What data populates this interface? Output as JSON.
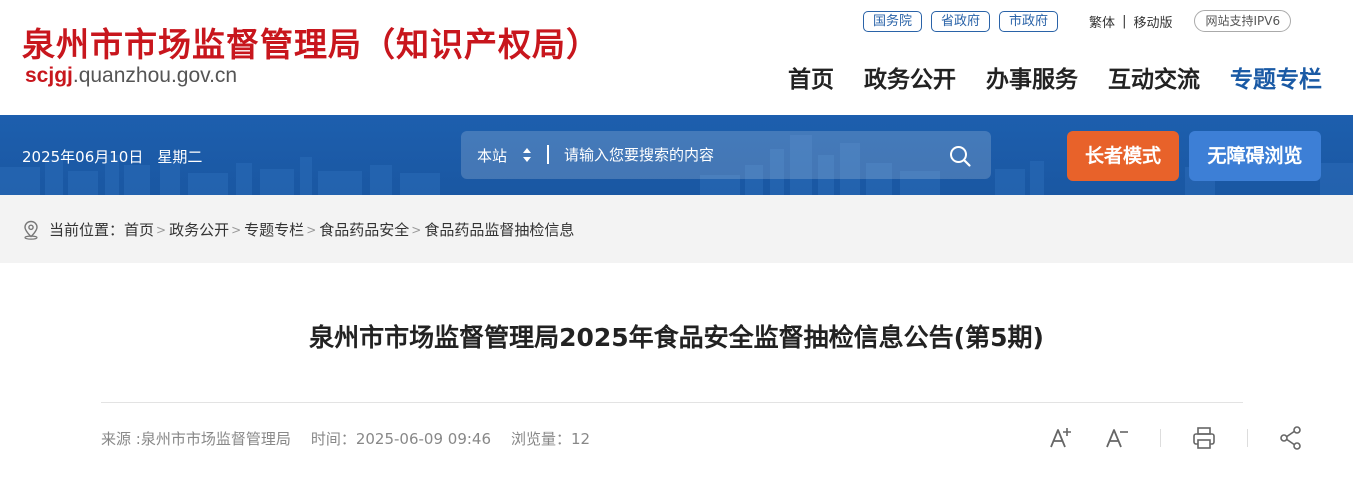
{
  "site": {
    "title": "泉州市市场监督管理局（知识产权局）",
    "domain_red": "scjgj",
    "domain_rest": ".quanzhou.gov.cn"
  },
  "top_links": {
    "pills": [
      "国务院",
      "省政府",
      "市政府"
    ],
    "traditional": "繁体",
    "separator": "|",
    "mobile": "移动版",
    "ipv6": "网站支持IPV6"
  },
  "main_nav": [
    "首页",
    "政务公开",
    "办事服务",
    "互动交流",
    "专题专栏"
  ],
  "main_nav_active": "专题专栏",
  "banner": {
    "date": "2025年06月10日",
    "weekday": "星期二",
    "search_scope": "本站",
    "search_placeholder": "请输入您要搜索的内容",
    "elder_mode": "长者模式",
    "accessible": "无障碍浏览"
  },
  "breadcrumb": {
    "prefix": "当前位置：",
    "items": [
      "首页",
      "政务公开",
      "专题专栏",
      "食品药品安全",
      "食品药品监督抽检信息"
    ]
  },
  "article": {
    "title": "泉州市市场监督管理局2025年食品安全监督抽检信息公告(第5期)",
    "source": "来源 :泉州市市场监督管理局",
    "time": "时间：2025-06-09 09:46",
    "views": "浏览量：12"
  },
  "colors": {
    "brand_red": "#c8161d",
    "banner_blue": "#1d5fae",
    "nav_active": "#1a5aa5",
    "elder_orange": "#e8622a",
    "accessible_blue": "#3d7fd6"
  },
  "icons": [
    "location-pin-icon",
    "search-icon",
    "font-increase-icon",
    "font-decrease-icon",
    "print-icon",
    "share-icon"
  ]
}
